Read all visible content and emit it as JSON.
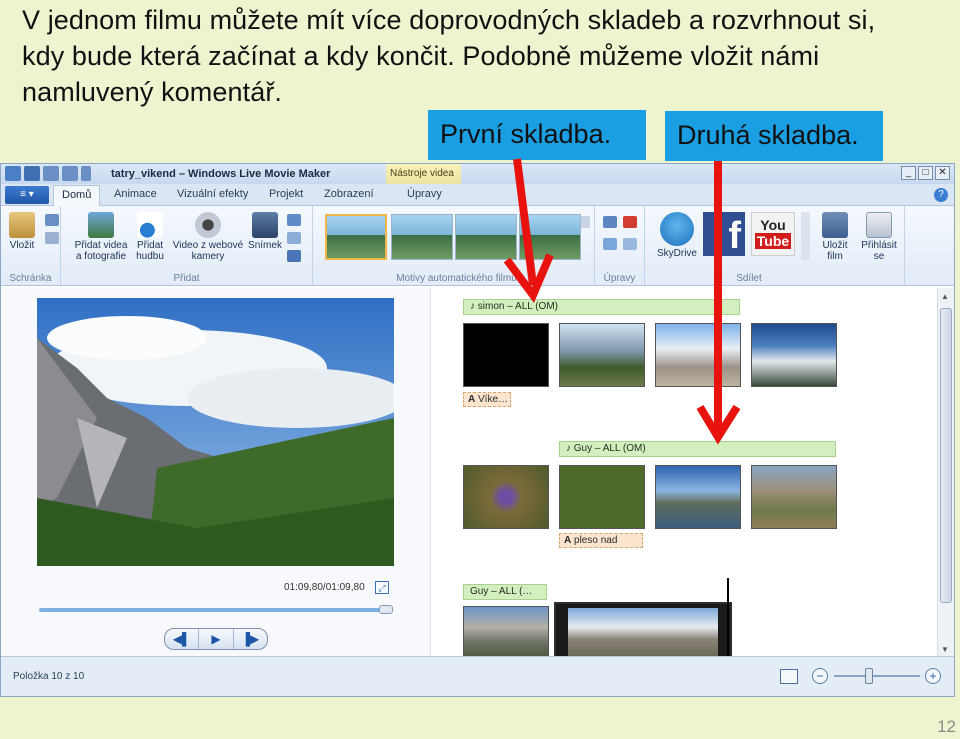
{
  "slide": {
    "body_text": "V jednom filmu můžete mít více doprovodných skladeb a rozvrhnout si, kdy bude která začínat a kdy končit. Podobně můžeme vložit námi namluvený komentář.",
    "callout_first": "První skladba.",
    "callout_second": "Druhá skladba.",
    "page_number": "12",
    "arrow_color": "#e8130e",
    "callout_color": "#1b9fe3"
  },
  "window": {
    "title": "tatry_vikend – Windows Live Movie Maker",
    "context_tab": "Nástroje videa",
    "buttons": [
      "_",
      "□",
      "✕"
    ]
  },
  "tabs": {
    "home": "Domů",
    "animations": "Animace",
    "visual_effects": "Vizuální efekty",
    "project": "Projekt",
    "view": "Zobrazení",
    "edit": "Úpravy"
  },
  "ribbon": {
    "clipboard_group": "Schránka",
    "paste": "Vložit",
    "add_group": "Přidat",
    "add_videos_line1": "Přidat videa",
    "add_videos_line2": "a fotografie",
    "add_music_line1": "Přidat",
    "add_music_line2": "hudbu",
    "webcam_line1": "Video z webové",
    "webcam_line2": "kamery",
    "snapshot": "Snímek",
    "autothemes_group": "Motivy automatického filmu",
    "editing_group": "Úpravy",
    "share_group": "Sdílet",
    "skydrive": "SkyDrive",
    "save_movie_line1": "Uložit",
    "save_movie_line2": "film",
    "sign_in_line1": "Přihlásit",
    "sign_in_line2": "se"
  },
  "preview": {
    "time": "01:09,80/01:09,80"
  },
  "storyboard": {
    "music1": "simon – ALL (OM)",
    "caption1": "Víke…",
    "music2": "Guy – ALL (OM)",
    "caption2": "pleso nad",
    "music3": "Guy – ALL (…"
  },
  "status": {
    "item_text": "Položka 10 z 10"
  }
}
